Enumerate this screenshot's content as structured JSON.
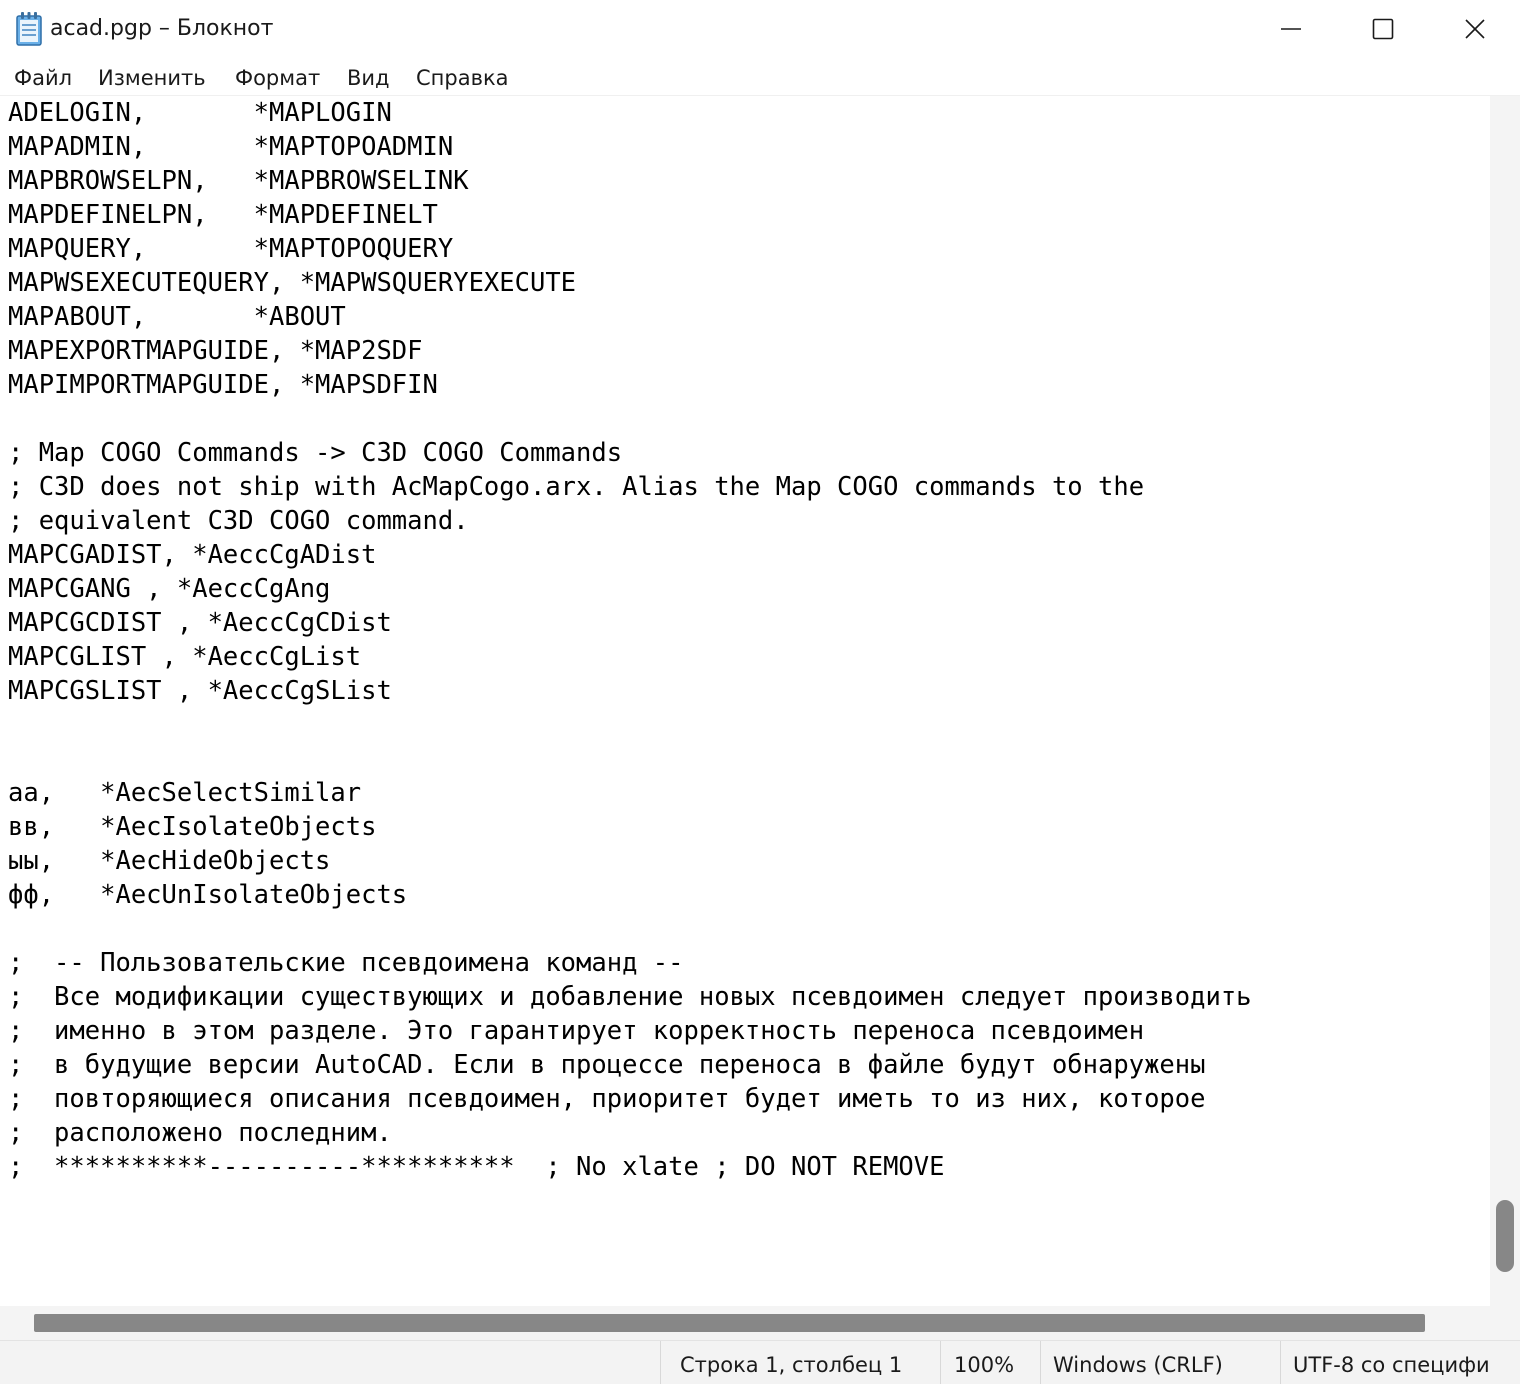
{
  "window": {
    "title": "acad.pgp – Блокнот",
    "icon": "notepad-icon"
  },
  "menu": {
    "file": "Файл",
    "edit": "Изменить",
    "format": "Формат",
    "view": "Вид",
    "help": "Справка"
  },
  "editor": {
    "lines": [
      "ADELOGIN,       *MAPLOGIN",
      "MAPADMIN,       *MAPTOPOADMIN",
      "MAPBROWSELPN,   *MAPBROWSELINK",
      "MAPDEFINELPN,   *MAPDEFINELT",
      "MAPQUERY,       *MAPTOPOQUERY",
      "MAPWSEXECUTEQUERY, *MAPWSQUERYEXECUTE",
      "MAPABOUT,       *ABOUT",
      "MAPEXPORTMAPGUIDE, *MAP2SDF",
      "MAPIMPORTMAPGUIDE, *MAPSDFIN",
      "",
      "; Map COGO Commands -> C3D COGO Commands",
      "; C3D does not ship with AcMapCogo.arx. Alias the Map COGO commands to the",
      "; equivalent C3D COGO command.",
      "MAPCGADIST, *AeccCgADist",
      "MAPCGANG , *AeccCgAng",
      "MAPCGCDIST , *AeccCgCDist",
      "MAPCGLIST , *AeccCgList",
      "MAPCGSLIST , *AeccCgSList",
      "",
      "",
      "аа,   *AecSelectSimilar",
      "вв,   *AecIsolateObjects",
      "ыы,   *AecHideObjects",
      "фф,   *AecUnIsolateObjects",
      "",
      ";  -- Пользовательские псевдоимена команд --",
      ";  Все модификации существующих и добавление новых псевдоимен следует производить",
      ";  именно в этом разделе. Это гарантирует корректность переноса псевдоимен",
      ";  в будущие версии AutoCAD. Если в процессе переноса в файле будут обнаружены",
      ";  повторяющиеся описания псевдоимен, приоритет будет иметь то из них, которое",
      ";  расположено последним.",
      ";  **********----------**********  ; No xlate ; DO NOT REMOVE"
    ]
  },
  "status": {
    "position": "Строка 1, столбец 1",
    "zoom": "100%",
    "line_endings": "Windows (CRLF)",
    "encoding": "UTF-8 со специфи"
  },
  "colors": {
    "scroll_thumb": "#878787",
    "statusbar_bg": "#f3f3f3"
  }
}
